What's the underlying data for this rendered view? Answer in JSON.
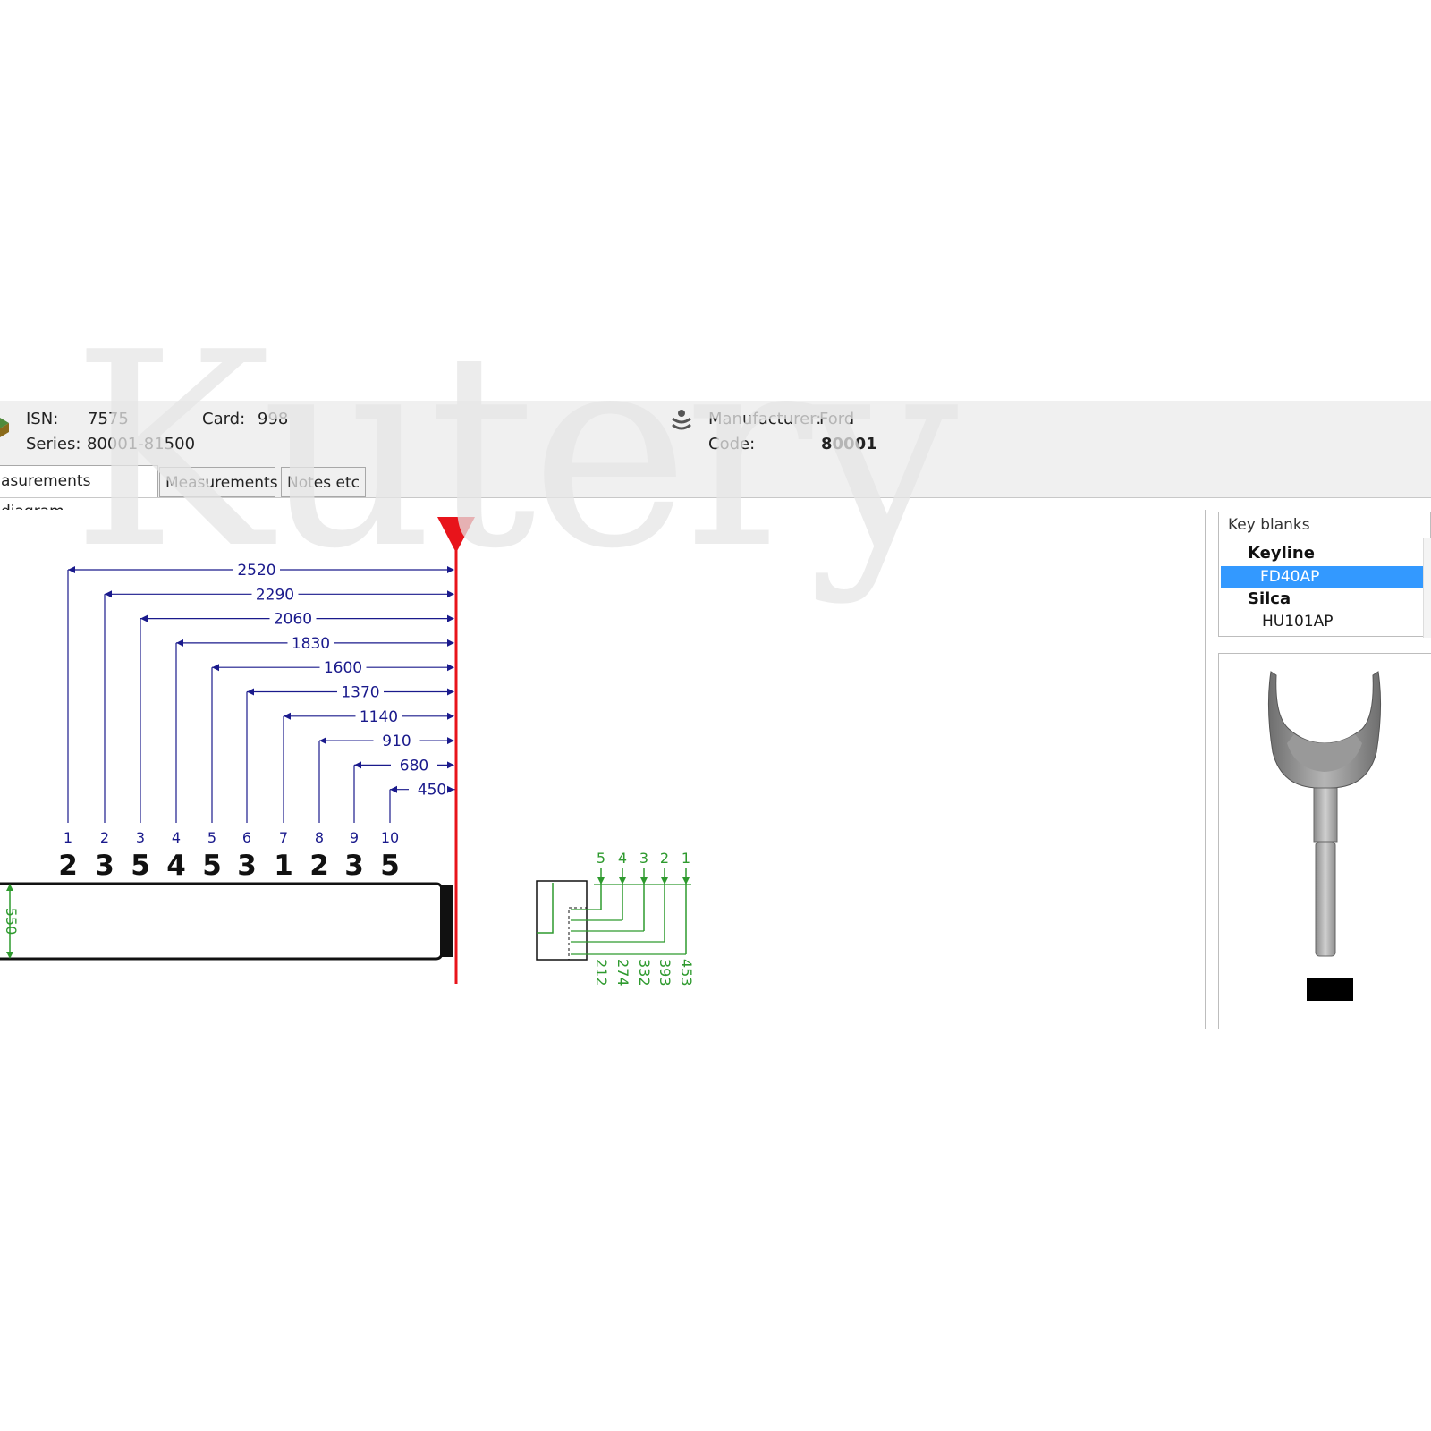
{
  "watermark": "Kutery",
  "header": {
    "isn_label": "ISN:",
    "isn_value": "7575",
    "card_label": "Card:",
    "card_value": "998",
    "series_label": "Series:",
    "series_value": "80001-81500",
    "manufacturer_label": "Manufacturer:",
    "manufacturer_value": "Ford",
    "code_label": "Code:",
    "code_value": "80001"
  },
  "tabs": [
    {
      "label": "asurements diagram",
      "active": true
    },
    {
      "label": "Measurements",
      "active": false
    },
    {
      "label": "Notes etc",
      "active": false
    }
  ],
  "diagram": {
    "spacing_lines": [
      "2520",
      "2290",
      "2060",
      "1830",
      "1600",
      "1370",
      "1140",
      "910",
      "680",
      "450"
    ],
    "cut_positions": [
      "1",
      "2",
      "3",
      "4",
      "5",
      "6",
      "7",
      "8",
      "9",
      "10"
    ],
    "cut_depths": [
      "2",
      "3",
      "5",
      "4",
      "5",
      "3",
      "1",
      "2",
      "3",
      "5"
    ],
    "blade_height": "550",
    "depth_indexes": [
      "5",
      "4",
      "3",
      "2",
      "1"
    ],
    "depth_values": [
      "212",
      "274",
      "332",
      "393",
      "453"
    ],
    "colors": {
      "dimension": "#1a1a8c",
      "depth": "#2e9a2e",
      "stop_line": "#e8141b"
    }
  },
  "key_blanks": {
    "title": "Key blanks",
    "groups": [
      {
        "name": "Keyline",
        "items": [
          "FD40AP"
        ]
      },
      {
        "name": "Silca",
        "items": [
          "HU101AP"
        ]
      }
    ],
    "selected": "FD40AP"
  },
  "icons": [
    "app-logo-icon",
    "manufacturer-logo-icon"
  ]
}
